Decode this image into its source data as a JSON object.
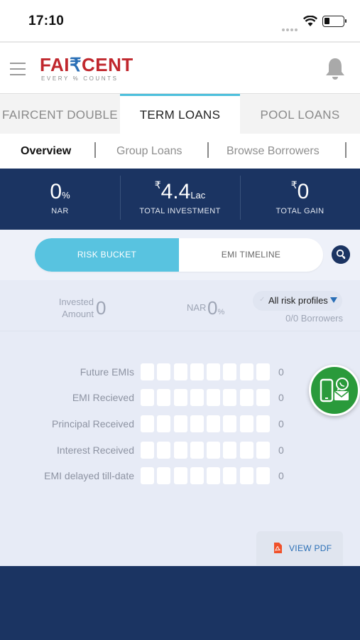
{
  "status_bar": {
    "time": "17:10"
  },
  "header": {
    "logo_part1": "FAI",
    "logo_rupee": "₹",
    "logo_part2": "CENT",
    "tagline": "EVERY % COUNTS"
  },
  "top_tabs": [
    {
      "label": "FAIRCENT DOUBLE",
      "active": false
    },
    {
      "label": "TERM LOANS",
      "active": true
    },
    {
      "label": "POOL LOANS",
      "active": false
    }
  ],
  "sub_tabs": [
    {
      "label": "Overview",
      "active": true
    },
    {
      "label": "Group Loans",
      "active": false
    },
    {
      "label": "Browse Borrowers",
      "active": false
    }
  ],
  "stats": {
    "nar": {
      "value": "0",
      "unit": "%",
      "label": "NAR"
    },
    "total_investment": {
      "symbol": "₹",
      "value": "4.4",
      "unit": "Lac",
      "label": "TOTAL INVESTMENT"
    },
    "total_gain": {
      "symbol": "₹",
      "value": "0",
      "label": "TOTAL GAIN"
    }
  },
  "segment": {
    "risk_bucket": "RISK BUCKET",
    "emi_timeline": "EMI TIMELINE",
    "active": "risk_bucket"
  },
  "summary": {
    "invested_label_line1": "Invested",
    "invested_label_line2": "Amount",
    "invested_value": "0",
    "nar_label": "NAR",
    "nar_value": "0",
    "nar_unit": "%",
    "profile_dropdown": "All risk profiles",
    "borrowers": "0/0 Borrowers"
  },
  "rows": [
    {
      "label": "Future EMIs",
      "value": "0"
    },
    {
      "label": "EMI Recieved",
      "value": "0"
    },
    {
      "label": "Principal Received",
      "value": "0"
    },
    {
      "label": "Interest Received",
      "value": "0"
    },
    {
      "label": "EMI delayed till-date",
      "value": "0"
    }
  ],
  "view_pdf": "VIEW PDF",
  "colors": {
    "navy": "#1b3462",
    "accent_cyan": "#58c3e0",
    "brand_red": "#c0272d",
    "link_blue": "#2a6fb6",
    "whatsapp_green": "#2a9a3b"
  }
}
